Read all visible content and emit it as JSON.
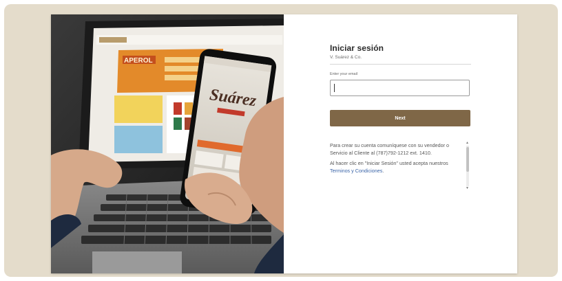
{
  "login": {
    "title": "Iniciar sesión",
    "company": "V. Suárez & Co.",
    "email_label": "Enter your email",
    "email_value": "",
    "next_label": "Next",
    "info_text_1": "Para crear su cuenta comuníquese con su vendedor o Servicio al Cliente al (787)792-1212 ext. 1410.",
    "info_text_2_prefix": "Al hacer clic en \"Iniciar Sesión\" usted acepta nuestros ",
    "terms_link": "Terminos y Condiciones",
    "info_text_2_suffix": "."
  },
  "photo": {
    "logo_text": "Suárez",
    "promo_text": "APEROL"
  },
  "colors": {
    "background": "#e4dccb",
    "accent": "#7f6747",
    "link": "#3a64a8"
  }
}
